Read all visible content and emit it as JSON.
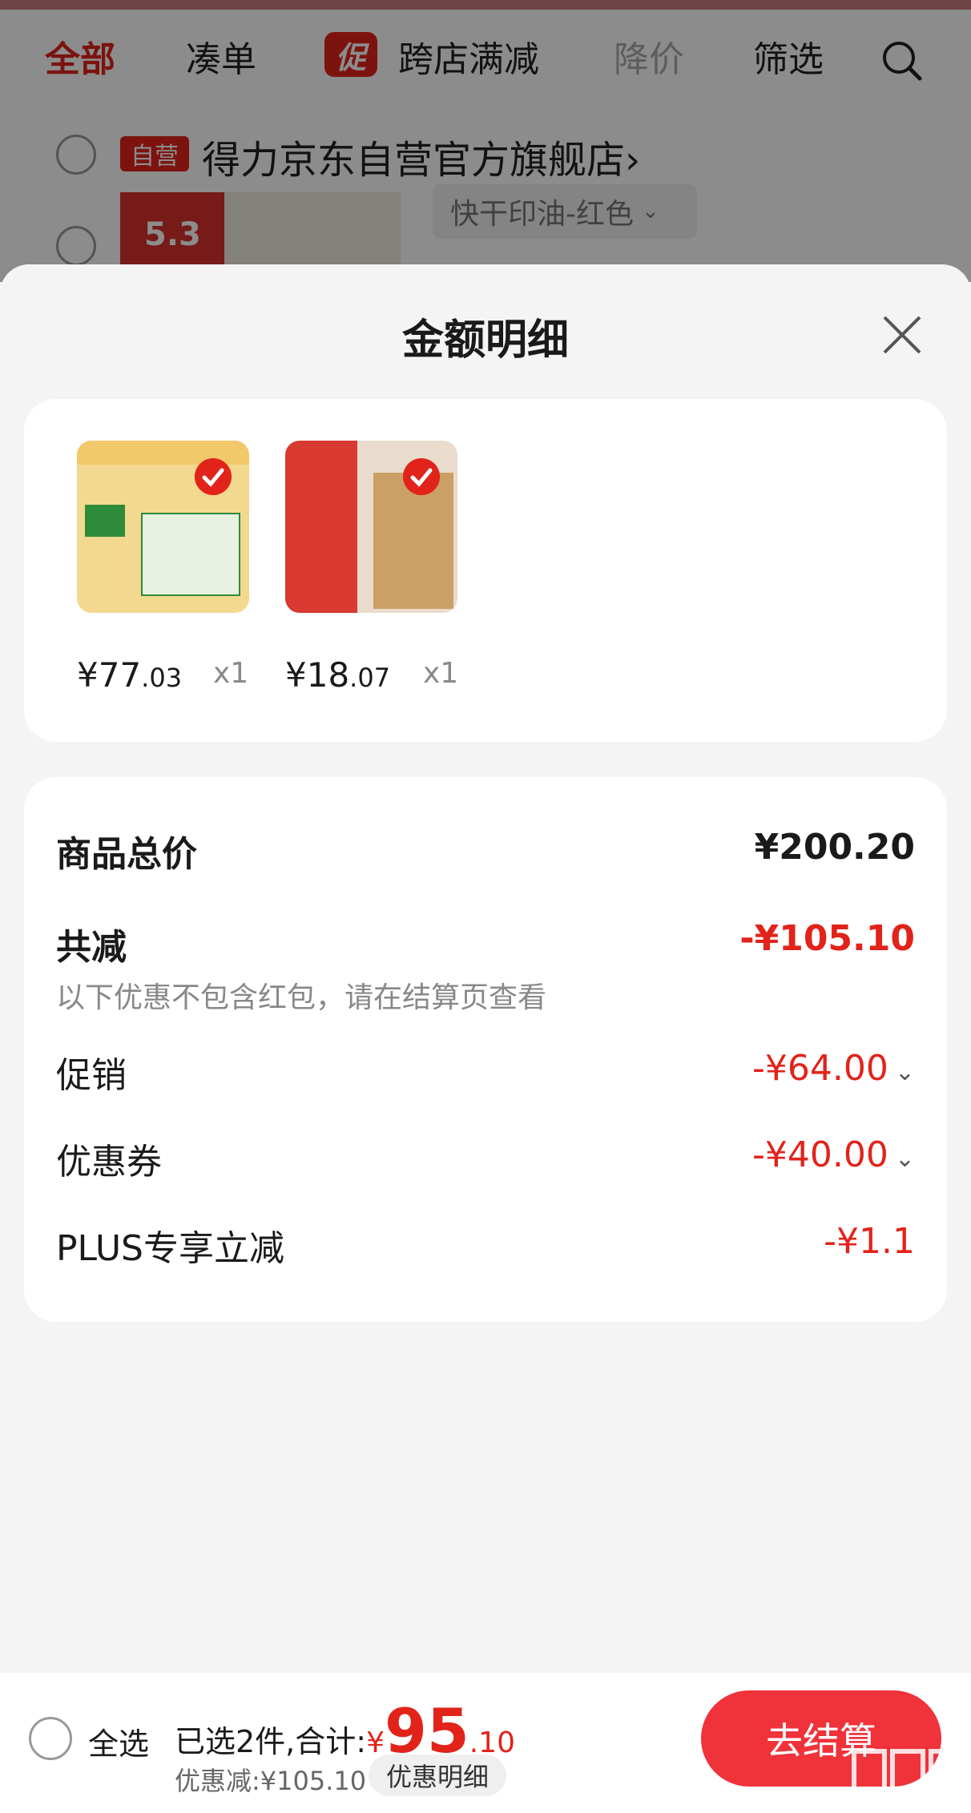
{
  "filters": {
    "all": "全部",
    "cou": "凑单",
    "promo_badge": "促",
    "cross_store": "跨店满减",
    "price_drop": "降价",
    "filter": "筛选"
  },
  "shop": {
    "badge": "自营",
    "name": "得力京东自营官方旗舰店",
    "arrow": "›",
    "product_price": "5.3",
    "variant": "快干印油-红色"
  },
  "sheet": {
    "title": "金额明细",
    "items": [
      {
        "price_int": "¥77",
        "price_dec": ".03",
        "qty": "x1"
      },
      {
        "price_int": "¥18",
        "price_dec": ".07",
        "qty": "x1"
      }
    ],
    "rows": {
      "subtotal_label": "商品总价",
      "subtotal_value": "¥200.20",
      "reduce_label": "共减",
      "reduce_value": "-¥105.10",
      "reduce_note": "以下优惠不包含红包，请在结算页查看",
      "promo_label": "促销",
      "promo_value": "-¥64.00",
      "coupon_label": "优惠券",
      "coupon_value": "-¥40.00",
      "plus_label": "PLUS专享立减",
      "plus_value": "-¥1.1"
    }
  },
  "bottom": {
    "select_all": "全选",
    "selected_text": "已选2件,合计:",
    "currency": "¥",
    "total_int": "95",
    "total_dec": ".10",
    "discount": "优惠减:¥105.10",
    "detail": "优惠明细",
    "checkout": "去结算"
  },
  "colors": {
    "accent": "#e2231a",
    "button": "#f0323a"
  }
}
